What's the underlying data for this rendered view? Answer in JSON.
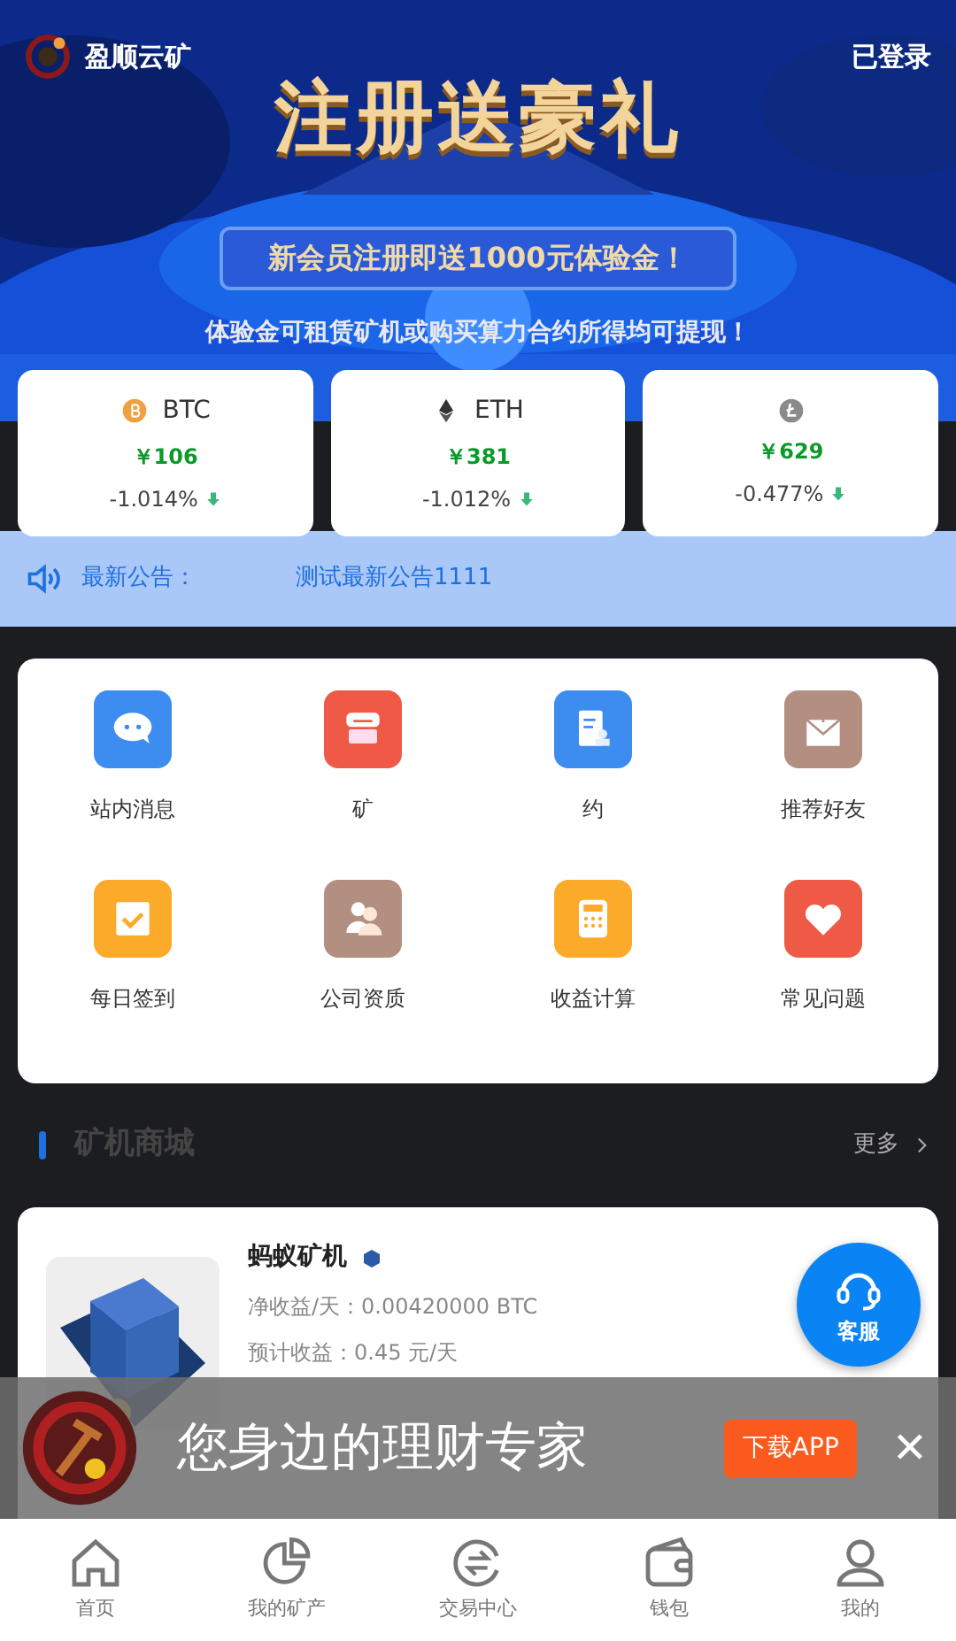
{
  "header": {
    "brand": "盈顺云矿",
    "login_status": "已登录"
  },
  "banner": {
    "kind": "picture",
    "headline": "注册送豪礼",
    "ribbon": "新会员注册即送1000元体验金！",
    "caption": "体验金可租赁矿机或购买算力合约所得均可提现！"
  },
  "tickers": [
    {
      "symbol": "BTC",
      "price": "￥106",
      "change": "-1.014%"
    },
    {
      "symbol": "ETH",
      "price": "￥381",
      "change": "-1.012%"
    },
    {
      "price": "￥629",
      "change": "-0.477%"
    }
  ],
  "notice": {
    "label": "最新公告：",
    "text": "测试最新公告1111"
  },
  "menu": [
    {
      "label": "站内消息",
      "color": "#3d8cf0"
    },
    {
      "label": "矿",
      "color": "#ee5a45"
    },
    {
      "label": "约",
      "color": "#3d8cf0"
    },
    {
      "label": "推荐好友",
      "color": "#b28f80"
    },
    {
      "label": "每日签到",
      "color": "#fbaa2a"
    },
    {
      "label": "公司资质",
      "color": "#b28f80"
    },
    {
      "label": "收益计算",
      "color": "#fbaa2a"
    },
    {
      "label": "常见问题",
      "color": "#ee5a45"
    }
  ],
  "section": {
    "title": "矿机商城",
    "more": "更多"
  },
  "product": {
    "name": "蚂蚁矿机",
    "income": "净收益/天：0.00420000 BTC",
    "expected": "预计收益：0.45 元/天"
  },
  "service": {
    "label": "客服"
  },
  "app_bar": {
    "slogan": "您身边的理财专家",
    "download": "下载APP",
    "close": "✕"
  },
  "tabbar": [
    {
      "label": "首页",
      "selected": false
    },
    {
      "label": "我的矿产",
      "selected": false
    },
    {
      "label": "交易中心",
      "selected": false
    },
    {
      "label": "钱包",
      "selected": false
    },
    {
      "label": "我的",
      "selected": false
    }
  ]
}
